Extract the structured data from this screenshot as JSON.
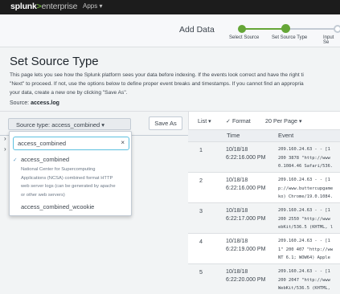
{
  "topbar": {
    "logo_brand": "splunk",
    "logo_sep": ">",
    "logo_product": "enterprise",
    "apps_label": "Apps ▾"
  },
  "wizard": {
    "title": "Add Data",
    "steps": [
      {
        "label": "Select Source"
      },
      {
        "label": "Set Source Type"
      },
      {
        "label": "Input Se"
      }
    ]
  },
  "main": {
    "title": "Set Source Type",
    "desc_lines": [
      "This page lets you see how the Splunk platform sees your data before indexing. If the events look correct and have the right ti",
      "\"Next\" to proceed. If not, use the options below to define proper event breaks and timestamps. If you cannot find an appropria",
      "your data, create a new one by clicking \"Save As\"."
    ],
    "source_label": "Source:",
    "source_value": "access.log"
  },
  "left": {
    "sourcetype_button": "Source type: access_combined ▾",
    "save_as": "Save As",
    "chevron": "›"
  },
  "dropdown": {
    "search_value": "access_combined",
    "clear_icon": "×",
    "check_icon": "✓",
    "item1": "access_combined",
    "item1_desc": [
      "National Center for Supercomputing",
      "Applications (NCSA) combined format HTTP",
      "web server logs (can be generated by apache",
      "or other web servers)"
    ],
    "item2": "access_combined_wcookie"
  },
  "preview": {
    "toolbar": {
      "list": "List ▾",
      "format": "✓ Format",
      "per_page": "20 Per Page ▾"
    },
    "columns": {
      "time": "Time",
      "event": "Event"
    },
    "rows": [
      {
        "num": "1",
        "date": "10/18/18",
        "time": "6:22:16.000 PM",
        "event1": "209.160.24.63 - - [1",
        "event2": " 200 3878 \"http://www",
        "event3": "0.1084.46 Safari/536."
      },
      {
        "num": "2",
        "date": "10/18/18",
        "time": "6:22:16.000 PM",
        "event1": "209.160.24.63 - - [1",
        "event2": "p://www.buttercupgame",
        "event3": "ko) Chrome/19.0.1084."
      },
      {
        "num": "3",
        "date": "10/18/18",
        "time": "6:22:17.000 PM",
        "event1": "209.160.24.63 - - [1",
        "event2": " 200 2550 \"http://www",
        "event3": "ebKit/536.5 (KHTML, l"
      },
      {
        "num": "4",
        "date": "10/18/18",
        "time": "6:22:19.000 PM",
        "event1": "209.160.24.63 - - [1",
        "event2": "1\" 200 407 \"http://ww",
        "event3": " NT 6.1; WOW64) Apple"
      },
      {
        "num": "5",
        "date": "10/18/18",
        "time": "6:22:20.000 PM",
        "event1": "209.160.24.63 - - [1",
        "event2": " 200 2047 \"http://www",
        "event3": "WebKit/536.5 (KHTML,"
      }
    ]
  },
  "colors": {
    "accent_green": "#65a637",
    "topbar": "#1c1c1c",
    "focus_blue": "#5cc0e0"
  }
}
